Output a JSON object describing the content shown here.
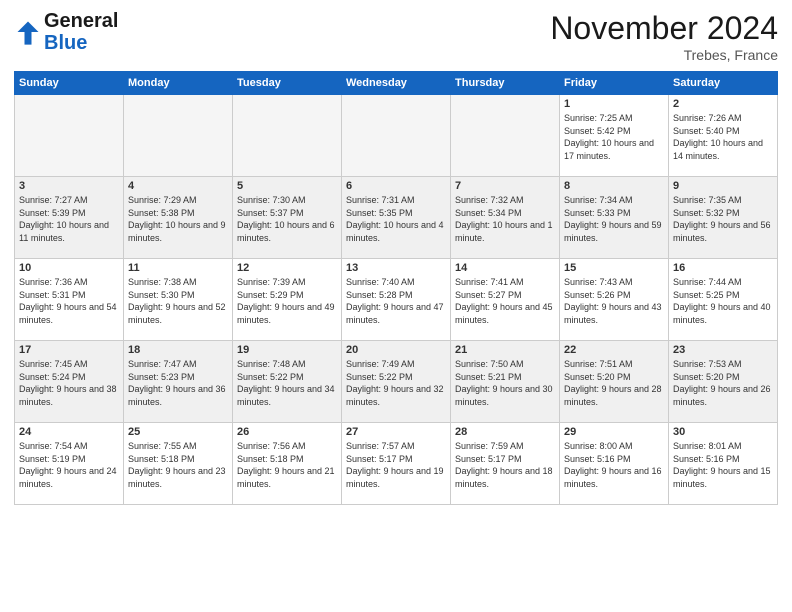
{
  "header": {
    "month_title": "November 2024",
    "location": "Trebes, France",
    "logo_general": "General",
    "logo_blue": "Blue"
  },
  "days_of_week": [
    "Sunday",
    "Monday",
    "Tuesday",
    "Wednesday",
    "Thursday",
    "Friday",
    "Saturday"
  ],
  "weeks": [
    [
      {
        "day": "",
        "empty": true
      },
      {
        "day": "",
        "empty": true
      },
      {
        "day": "",
        "empty": true
      },
      {
        "day": "",
        "empty": true
      },
      {
        "day": "",
        "empty": true
      },
      {
        "day": "1",
        "sunrise": "Sunrise: 7:25 AM",
        "sunset": "Sunset: 5:42 PM",
        "daylight": "Daylight: 10 hours and 17 minutes."
      },
      {
        "day": "2",
        "sunrise": "Sunrise: 7:26 AM",
        "sunset": "Sunset: 5:40 PM",
        "daylight": "Daylight: 10 hours and 14 minutes."
      }
    ],
    [
      {
        "day": "3",
        "sunrise": "Sunrise: 7:27 AM",
        "sunset": "Sunset: 5:39 PM",
        "daylight": "Daylight: 10 hours and 11 minutes."
      },
      {
        "day": "4",
        "sunrise": "Sunrise: 7:29 AM",
        "sunset": "Sunset: 5:38 PM",
        "daylight": "Daylight: 10 hours and 9 minutes."
      },
      {
        "day": "5",
        "sunrise": "Sunrise: 7:30 AM",
        "sunset": "Sunset: 5:37 PM",
        "daylight": "Daylight: 10 hours and 6 minutes."
      },
      {
        "day": "6",
        "sunrise": "Sunrise: 7:31 AM",
        "sunset": "Sunset: 5:35 PM",
        "daylight": "Daylight: 10 hours and 4 minutes."
      },
      {
        "day": "7",
        "sunrise": "Sunrise: 7:32 AM",
        "sunset": "Sunset: 5:34 PM",
        "daylight": "Daylight: 10 hours and 1 minute."
      },
      {
        "day": "8",
        "sunrise": "Sunrise: 7:34 AM",
        "sunset": "Sunset: 5:33 PM",
        "daylight": "Daylight: 9 hours and 59 minutes."
      },
      {
        "day": "9",
        "sunrise": "Sunrise: 7:35 AM",
        "sunset": "Sunset: 5:32 PM",
        "daylight": "Daylight: 9 hours and 56 minutes."
      }
    ],
    [
      {
        "day": "10",
        "sunrise": "Sunrise: 7:36 AM",
        "sunset": "Sunset: 5:31 PM",
        "daylight": "Daylight: 9 hours and 54 minutes."
      },
      {
        "day": "11",
        "sunrise": "Sunrise: 7:38 AM",
        "sunset": "Sunset: 5:30 PM",
        "daylight": "Daylight: 9 hours and 52 minutes."
      },
      {
        "day": "12",
        "sunrise": "Sunrise: 7:39 AM",
        "sunset": "Sunset: 5:29 PM",
        "daylight": "Daylight: 9 hours and 49 minutes."
      },
      {
        "day": "13",
        "sunrise": "Sunrise: 7:40 AM",
        "sunset": "Sunset: 5:28 PM",
        "daylight": "Daylight: 9 hours and 47 minutes."
      },
      {
        "day": "14",
        "sunrise": "Sunrise: 7:41 AM",
        "sunset": "Sunset: 5:27 PM",
        "daylight": "Daylight: 9 hours and 45 minutes."
      },
      {
        "day": "15",
        "sunrise": "Sunrise: 7:43 AM",
        "sunset": "Sunset: 5:26 PM",
        "daylight": "Daylight: 9 hours and 43 minutes."
      },
      {
        "day": "16",
        "sunrise": "Sunrise: 7:44 AM",
        "sunset": "Sunset: 5:25 PM",
        "daylight": "Daylight: 9 hours and 40 minutes."
      }
    ],
    [
      {
        "day": "17",
        "sunrise": "Sunrise: 7:45 AM",
        "sunset": "Sunset: 5:24 PM",
        "daylight": "Daylight: 9 hours and 38 minutes."
      },
      {
        "day": "18",
        "sunrise": "Sunrise: 7:47 AM",
        "sunset": "Sunset: 5:23 PM",
        "daylight": "Daylight: 9 hours and 36 minutes."
      },
      {
        "day": "19",
        "sunrise": "Sunrise: 7:48 AM",
        "sunset": "Sunset: 5:22 PM",
        "daylight": "Daylight: 9 hours and 34 minutes."
      },
      {
        "day": "20",
        "sunrise": "Sunrise: 7:49 AM",
        "sunset": "Sunset: 5:22 PM",
        "daylight": "Daylight: 9 hours and 32 minutes."
      },
      {
        "day": "21",
        "sunrise": "Sunrise: 7:50 AM",
        "sunset": "Sunset: 5:21 PM",
        "daylight": "Daylight: 9 hours and 30 minutes."
      },
      {
        "day": "22",
        "sunrise": "Sunrise: 7:51 AM",
        "sunset": "Sunset: 5:20 PM",
        "daylight": "Daylight: 9 hours and 28 minutes."
      },
      {
        "day": "23",
        "sunrise": "Sunrise: 7:53 AM",
        "sunset": "Sunset: 5:20 PM",
        "daylight": "Daylight: 9 hours and 26 minutes."
      }
    ],
    [
      {
        "day": "24",
        "sunrise": "Sunrise: 7:54 AM",
        "sunset": "Sunset: 5:19 PM",
        "daylight": "Daylight: 9 hours and 24 minutes."
      },
      {
        "day": "25",
        "sunrise": "Sunrise: 7:55 AM",
        "sunset": "Sunset: 5:18 PM",
        "daylight": "Daylight: 9 hours and 23 minutes."
      },
      {
        "day": "26",
        "sunrise": "Sunrise: 7:56 AM",
        "sunset": "Sunset: 5:18 PM",
        "daylight": "Daylight: 9 hours and 21 minutes."
      },
      {
        "day": "27",
        "sunrise": "Sunrise: 7:57 AM",
        "sunset": "Sunset: 5:17 PM",
        "daylight": "Daylight: 9 hours and 19 minutes."
      },
      {
        "day": "28",
        "sunrise": "Sunrise: 7:59 AM",
        "sunset": "Sunset: 5:17 PM",
        "daylight": "Daylight: 9 hours and 18 minutes."
      },
      {
        "day": "29",
        "sunrise": "Sunrise: 8:00 AM",
        "sunset": "Sunset: 5:16 PM",
        "daylight": "Daylight: 9 hours and 16 minutes."
      },
      {
        "day": "30",
        "sunrise": "Sunrise: 8:01 AM",
        "sunset": "Sunset: 5:16 PM",
        "daylight": "Daylight: 9 hours and 15 minutes."
      }
    ]
  ]
}
